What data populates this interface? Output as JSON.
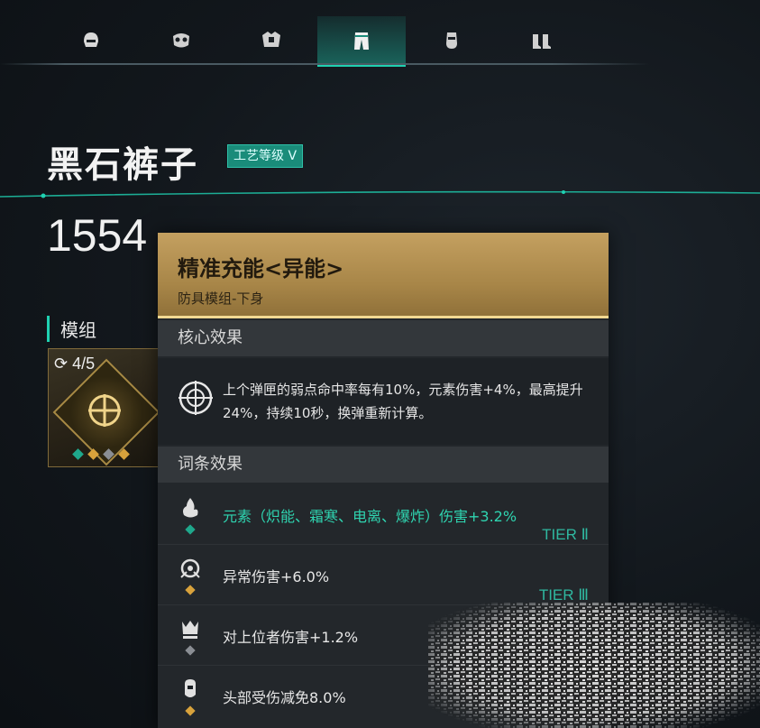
{
  "tabs": [
    {
      "icon": "helmet-icon",
      "active": false
    },
    {
      "icon": "mask-icon",
      "active": false
    },
    {
      "icon": "armor-icon",
      "active": false
    },
    {
      "icon": "pants-icon",
      "active": true
    },
    {
      "icon": "glove-icon",
      "active": false
    },
    {
      "icon": "boots-icon",
      "active": false
    }
  ],
  "item": {
    "name": "黑石裤子",
    "craft_badge": "工艺等级 V",
    "score": "1554"
  },
  "module": {
    "label": "模组",
    "count": "4/5",
    "dots": [
      "#1fa88c",
      "#d8a23c",
      "#8a8e94",
      "#d8a23c"
    ]
  },
  "tooltip": {
    "name": "精准充能<异能>",
    "subtitle": "防具模组-下身",
    "core_header": "核心效果",
    "core_text": "上个弹匣的弱点命中率每有10%，元素伤害+4%，最高提升24%，持续10秒，换弹重新计算。",
    "affix_header": "词条效果",
    "affixes": [
      {
        "text": "元素（炽能、霜寒、电离、爆炸）伤害+3.2%",
        "tier": "TIER Ⅱ",
        "highlight": true,
        "dot": "#1fa88c",
        "icon": "elements-icon"
      },
      {
        "text": "异常伤害+6.0%",
        "tier": "TIER Ⅲ",
        "highlight": false,
        "dot": "#d8a23c",
        "icon": "anomaly-icon"
      },
      {
        "text": "对上位者伤害+1.2%",
        "tier": "",
        "highlight": false,
        "dot": "#8a8e94",
        "icon": "boss-icon"
      },
      {
        "text": "头部受伤减免8.0%",
        "tier": "",
        "highlight": false,
        "dot": "#d8a23c",
        "icon": "head-shield-icon"
      }
    ]
  }
}
